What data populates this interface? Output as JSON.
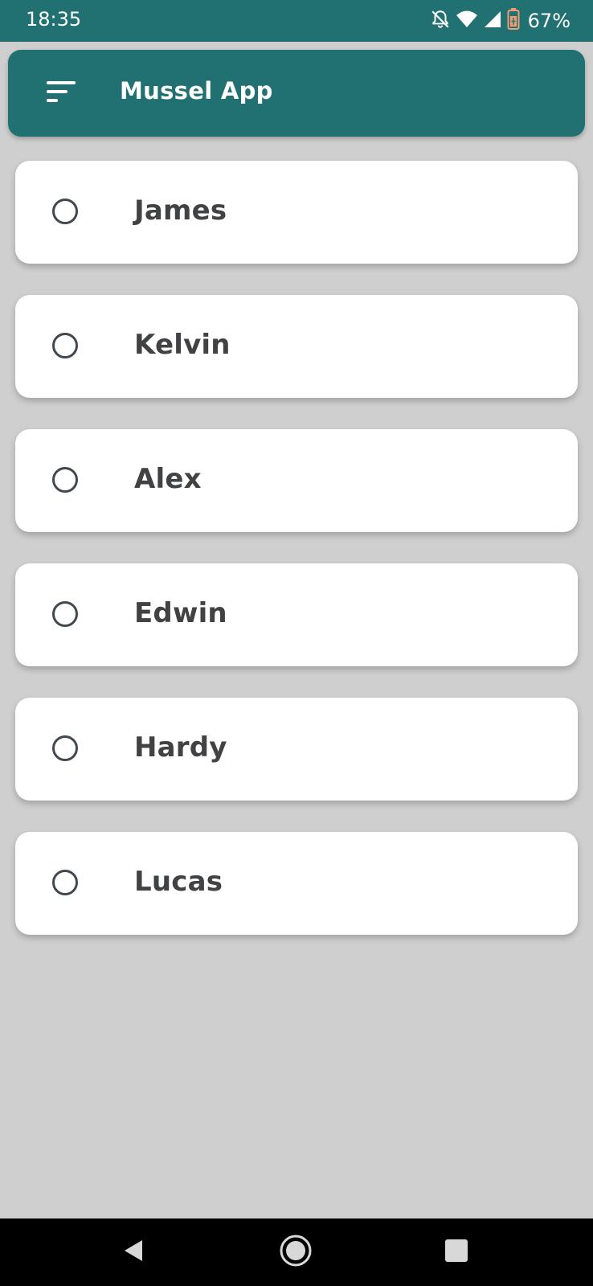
{
  "status_bar": {
    "time": "18:35",
    "battery_percent": "67%",
    "icons": [
      "notifications-off-icon",
      "wifi-icon",
      "cell-signal-icon",
      "battery-saver-icon"
    ]
  },
  "app_bar": {
    "title": "Mussel App",
    "menu_icon": "sort-menu-icon",
    "color": "#217172"
  },
  "list": {
    "items": [
      {
        "label": "James",
        "selected": false
      },
      {
        "label": "Kelvin",
        "selected": false
      },
      {
        "label": "Alex",
        "selected": false
      },
      {
        "label": "Edwin",
        "selected": false
      },
      {
        "label": "Hardy",
        "selected": false
      },
      {
        "label": "Lucas",
        "selected": false
      }
    ]
  },
  "nav_bar": {
    "buttons": [
      "back-icon",
      "home-icon",
      "recents-icon"
    ]
  }
}
